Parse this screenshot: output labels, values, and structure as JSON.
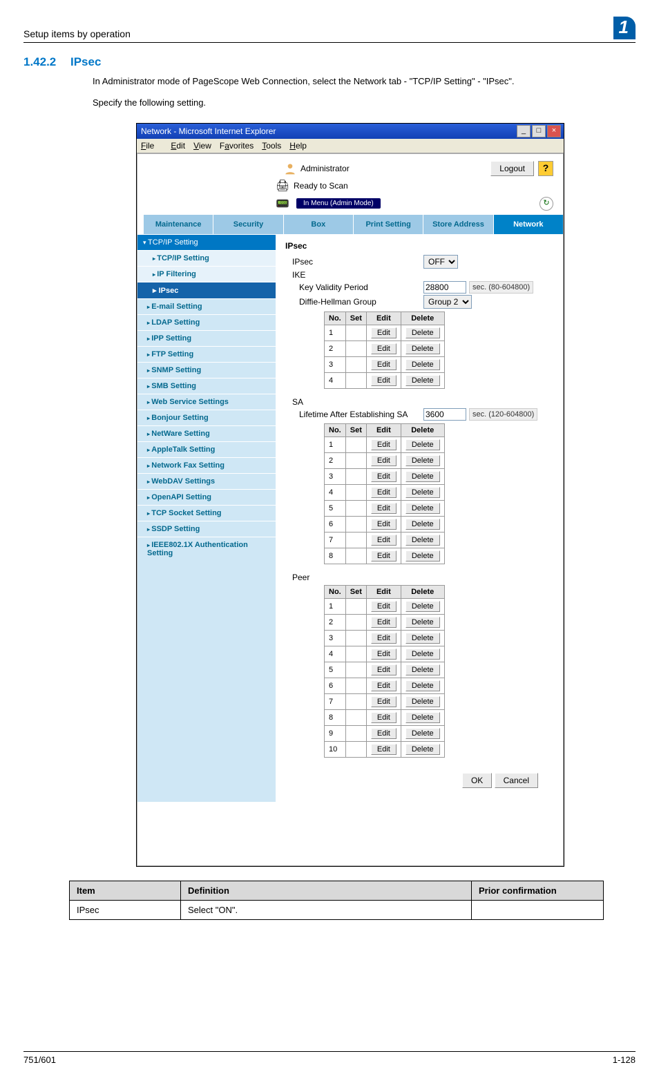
{
  "runhead": "Setup items by operation",
  "chapter_num": "1",
  "section_num": "1.42.2",
  "section_title": "IPsec",
  "body1": "In Administrator mode of PageScope Web Connection, select the Network tab - \"TCP/IP Setting\" - \"IPsec\".",
  "body2": "Specify the following setting.",
  "win": {
    "title": "Network - Microsoft Internet Explorer",
    "menus": {
      "file": "File",
      "edit": "Edit",
      "view": "View",
      "fav": "Favorites",
      "tools": "Tools",
      "help": "Help"
    },
    "admin": "Administrator",
    "logout": "Logout",
    "help": "?",
    "ready": "Ready to Scan",
    "inmenu": "In Menu (Admin Mode)"
  },
  "tabs": {
    "maintenance": "Maintenance",
    "security": "Security",
    "box": "Box",
    "print": "Print Setting",
    "store": "Store Address",
    "network": "Network"
  },
  "side": {
    "tcpip_grp": "TCP/IP Setting",
    "tcpip": "TCP/IP Setting",
    "ipfilter": "IP Filtering",
    "ipsec": "IPsec",
    "email": "E-mail Setting",
    "ldap": "LDAP Setting",
    "ipp": "IPP Setting",
    "ftp": "FTP Setting",
    "snmp": "SNMP Setting",
    "smb": "SMB Setting",
    "websvc": "Web Service Settings",
    "bonjour": "Bonjour Setting",
    "netware": "NetWare Setting",
    "appletalk": "AppleTalk Setting",
    "netfax": "Network Fax Setting",
    "webdav": "WebDAV Settings",
    "openapi": "OpenAPI Setting",
    "tcpsock": "TCP Socket Setting",
    "ssdp": "SSDP Setting",
    "ieee": "IEEE802.1X Authentication Setting"
  },
  "form": {
    "h1": "IPsec",
    "ipsec_lab": "IPsec",
    "ipsec_val": "OFF",
    "ike_lab": "IKE",
    "kvp_lab": "Key Validity Period",
    "kvp_val": "28800",
    "kvp_unit": "sec. (80-604800)",
    "dh_lab": "Diffie-Hellman Group",
    "dh_val": "Group 2",
    "tbl_hdr": {
      "no": "No.",
      "set": "Set",
      "edit": "Edit",
      "delete": "Delete"
    },
    "edit_btn": "Edit",
    "delete_btn": "Delete",
    "sa_lab": "SA",
    "sa_life_lab": "Lifetime After Establishing SA",
    "sa_life_val": "3600",
    "sa_life_unit": "sec. (120-604800)",
    "peer_lab": "Peer",
    "ok": "OK",
    "cancel": "Cancel",
    "ike_rows": [
      1,
      2,
      3,
      4
    ],
    "sa_rows": [
      1,
      2,
      3,
      4,
      5,
      6,
      7,
      8
    ],
    "peer_rows": [
      1,
      2,
      3,
      4,
      5,
      6,
      7,
      8,
      9,
      10
    ]
  },
  "deftbl": {
    "h_item": "Item",
    "h_def": "Definition",
    "h_prior": "Prior confirmation",
    "r1_item": "IPsec",
    "r1_def": "Select \"ON\".",
    "r1_prior": ""
  },
  "footer_left": "751/601",
  "footer_right": "1-128"
}
